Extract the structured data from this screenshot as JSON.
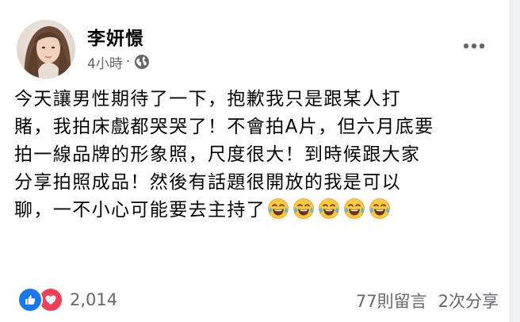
{
  "post": {
    "author_name": "李妍憬",
    "timestamp": "4小時",
    "separator": "·",
    "audience_icon": "globe-icon",
    "more_icon": "more-horizontal-icon",
    "text_lines": [
      "今天讓男性期待了一下，抱歉我只是跟某人打",
      "賭，我拍床戲都哭哭了！不會拍A片，但六月底要",
      "拍一線品牌的形象照，尺度很大！到時候跟大家",
      "分享拍照成品！然後有話題很開放的我是可以",
      "聊，一不小心可能要去主持了"
    ],
    "emoji_icon": "face-with-tears-of-joy-icon",
    "emoji_count": 5
  },
  "footer": {
    "reaction_icons": [
      "like-icon",
      "love-icon"
    ],
    "reaction_count": "2,014",
    "comments": "77則留言",
    "shares": "2次分享"
  },
  "colors": {
    "text_primary": "#050505",
    "text_secondary": "#65676b",
    "like_blue": "#1877f2",
    "love_red": "#f33e58",
    "emoji_yellow": "#ffc83d"
  }
}
